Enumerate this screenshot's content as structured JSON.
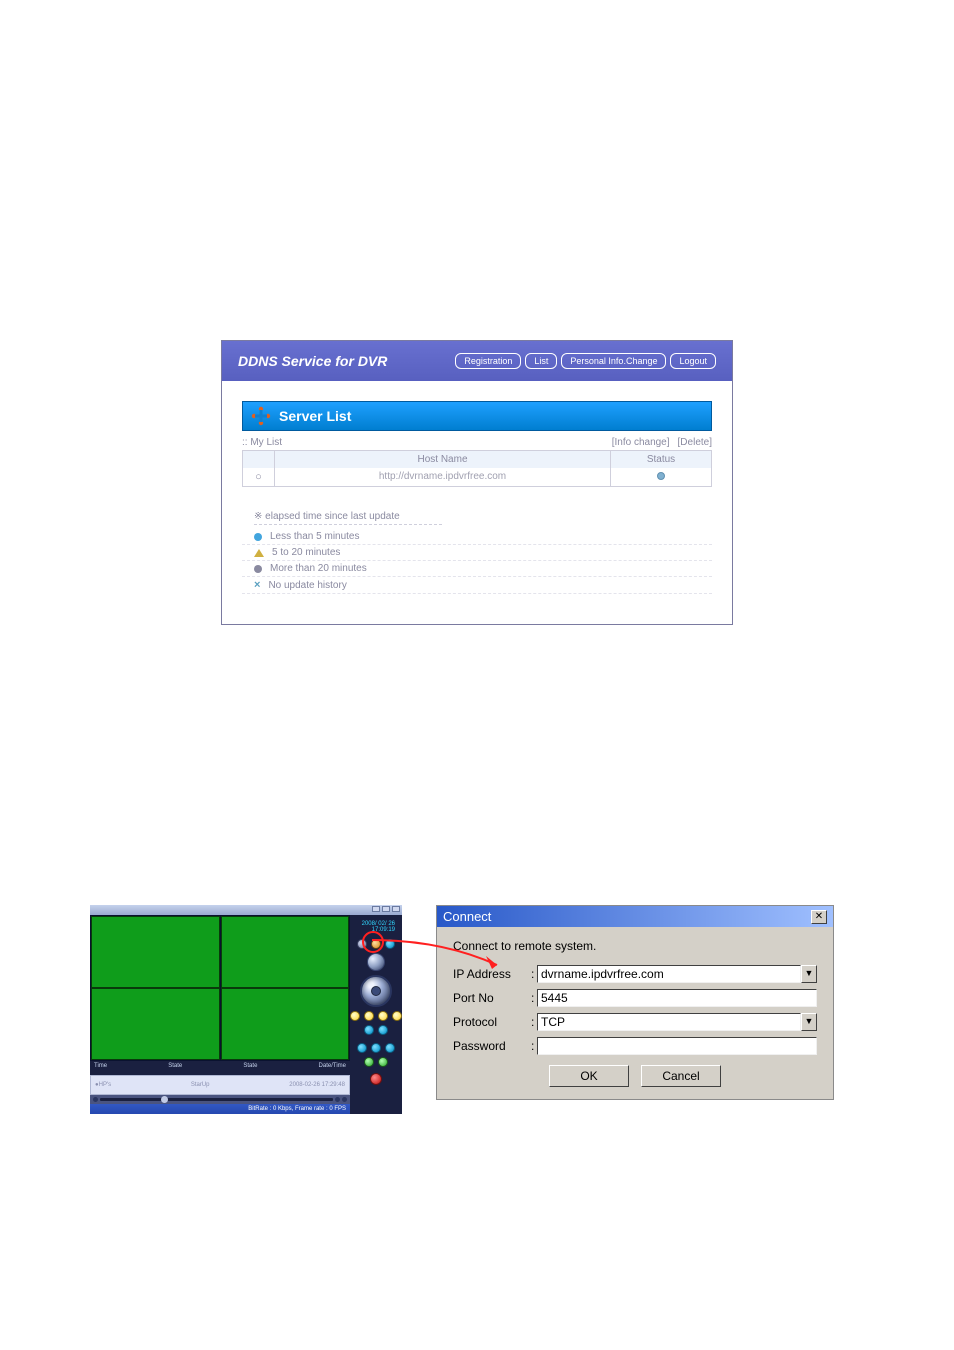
{
  "ddns": {
    "title": "DDNS Service for DVR",
    "nav": {
      "registration": "Registration",
      "list": "List",
      "personal": "Personal Info.Change",
      "logout": "Logout"
    },
    "server_list_title": "Server List",
    "my_list": ":: My List",
    "links": {
      "info_change": "[Info change]",
      "delete": "[Delete]"
    },
    "columns": {
      "hostname": "Host Name",
      "status": "Status"
    },
    "row0": {
      "radio": "○",
      "hostname": "http://dvrname.ipdvrfree.com"
    },
    "legend": {
      "title": "※ elapsed time since last update",
      "l1": "Less than 5 minutes",
      "l2": "5 to 20 minutes",
      "l3": "More than 20 minutes",
      "l4": "No update history"
    }
  },
  "viewer": {
    "clock": "2008/ 02/ 26 17:09:19",
    "timecols": {
      "c1": "Time",
      "c2": "State",
      "c3": "State",
      "c4": "Date/Time"
    },
    "botleft": "●HP's",
    "datecell": "2008-02-26 17:29:48",
    "statecell": "StarUp",
    "status": "BitRate : 0 Kbps, Frame rate : 0 FPS"
  },
  "connect": {
    "title": "Connect",
    "desc": "Connect to remote system.",
    "labels": {
      "ip": "IP Address",
      "port": "Port No",
      "protocol": "Protocol",
      "password": "Password"
    },
    "ip_value": "dvrname.ipdvrfree.com",
    "port_value": "5445",
    "protocol_value": "TCP",
    "password_value": "",
    "ok": "OK",
    "cancel": "Cancel",
    "close": "✕"
  }
}
